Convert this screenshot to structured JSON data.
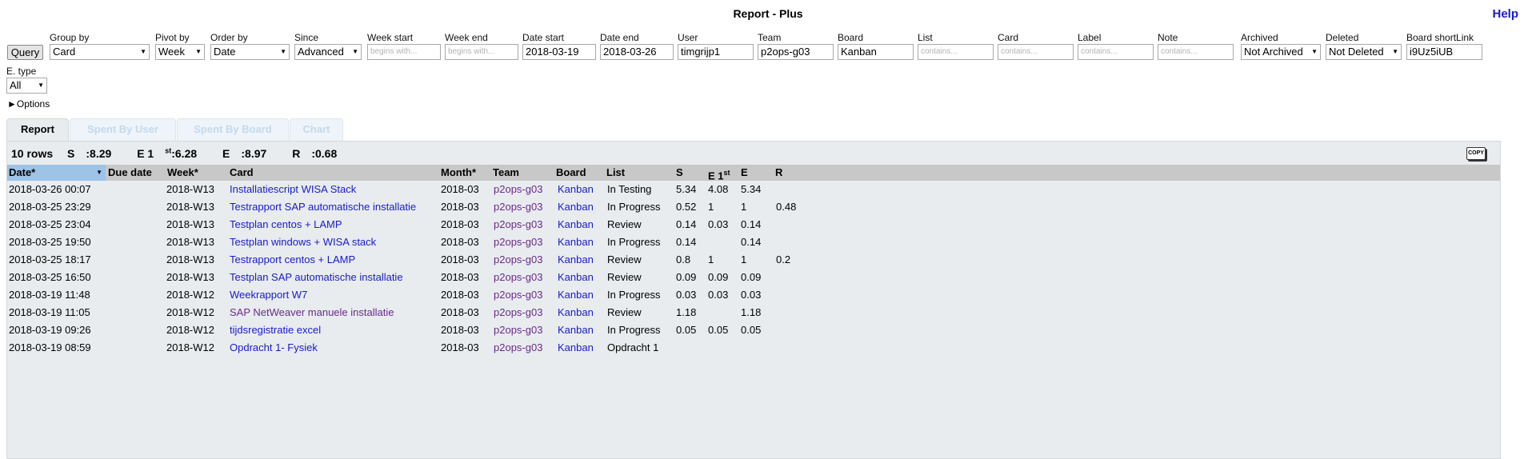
{
  "app": {
    "title": "Report - Plus",
    "help": "Help"
  },
  "query": {
    "label": "Query"
  },
  "filters": {
    "group_by": {
      "label": "Group by",
      "value": "Card"
    },
    "pivot_by": {
      "label": "Pivot by",
      "value": "Week"
    },
    "order_by": {
      "label": "Order by",
      "value": "Date"
    },
    "since": {
      "label": "Since",
      "value": "Advanced"
    },
    "week_start": {
      "label": "Week start",
      "placeholder": "begins with..."
    },
    "week_end": {
      "label": "Week end",
      "placeholder": "begins with..."
    },
    "date_start": {
      "label": "Date start",
      "value": "2018-03-19"
    },
    "date_end": {
      "label": "Date end",
      "value": "2018-03-26"
    },
    "user": {
      "label": "User",
      "value": "timgrijp1"
    },
    "team": {
      "label": "Team",
      "value": "p2ops-g03"
    },
    "board": {
      "label": "Board",
      "value": "Kanban"
    },
    "list": {
      "label": "List",
      "placeholder": "contains..."
    },
    "card": {
      "label": "Card",
      "placeholder": "contains..."
    },
    "label": {
      "label": "Label",
      "placeholder": "contains..."
    },
    "note": {
      "label": "Note",
      "placeholder": "contains..."
    },
    "archived": {
      "label": "Archived",
      "value": "Not Archived"
    },
    "deleted": {
      "label": "Deleted",
      "value": "Not Deleted"
    },
    "board_shortlink": {
      "label": "Board shortLink",
      "value": "i9Uz5iUB"
    },
    "e_type": {
      "label": "E. type",
      "value": "All"
    }
  },
  "options": {
    "label": "►Options"
  },
  "tabs": [
    {
      "label": "Report",
      "active": true
    },
    {
      "label": "Spent By User",
      "active": false
    },
    {
      "label": "Spent By Board",
      "active": false
    },
    {
      "label": "Chart",
      "active": false
    }
  ],
  "summary": {
    "rows": "10 rows",
    "s_label": "S",
    "s_value": "8.29",
    "e1_label": "E 1",
    "e1_sup": "st",
    "e1_value": "6.28",
    "e_label": "E",
    "e_value": "8.97",
    "r_label": "R",
    "r_value": "0.68"
  },
  "copy": {
    "label": "COPY"
  },
  "columns": {
    "date": "Date*",
    "due": "Due date",
    "week": "Week*",
    "card": "Card",
    "month": "Month*",
    "team": "Team",
    "board": "Board",
    "list": "List",
    "s": "S",
    "e1": "E 1",
    "e1_sup": "st",
    "e": "E",
    "r": "R"
  },
  "rows": [
    {
      "date": "2018-03-26 00:07",
      "due": "",
      "week": "2018-W13",
      "card": "Installatiescript WISA Stack",
      "month": "2018-03",
      "team": "p2ops-g03",
      "board": "Kanban",
      "list": "In Testing",
      "s": "5.34",
      "e1": "4.08",
      "e": "5.34",
      "r": ""
    },
    {
      "date": "2018-03-25 23:29",
      "due": "",
      "week": "2018-W13",
      "card": "Testrapport SAP automatische installatie",
      "month": "2018-03",
      "team": "p2ops-g03",
      "board": "Kanban",
      "list": "In Progress",
      "s": "0.52",
      "e1": "1",
      "e": "1",
      "r": "0.48"
    },
    {
      "date": "2018-03-25 23:04",
      "due": "",
      "week": "2018-W13",
      "card": "Testplan centos + LAMP",
      "month": "2018-03",
      "team": "p2ops-g03",
      "board": "Kanban",
      "list": "Review",
      "s": "0.14",
      "e1": "0.03",
      "e": "0.14",
      "r": ""
    },
    {
      "date": "2018-03-25 19:50",
      "due": "",
      "week": "2018-W13",
      "card": "Testplan windows + WISA stack",
      "month": "2018-03",
      "team": "p2ops-g03",
      "board": "Kanban",
      "list": "In Progress",
      "s": "0.14",
      "e1": "",
      "e": "0.14",
      "r": ""
    },
    {
      "date": "2018-03-25 18:17",
      "due": "",
      "week": "2018-W13",
      "card": "Testrapport centos + LAMP",
      "month": "2018-03",
      "team": "p2ops-g03",
      "board": "Kanban",
      "list": "Review",
      "s": "0.8",
      "e1": "1",
      "e": "1",
      "r": "0.2"
    },
    {
      "date": "2018-03-25 16:50",
      "due": "",
      "week": "2018-W13",
      "card": "Testplan SAP automatische installatie",
      "month": "2018-03",
      "team": "p2ops-g03",
      "board": "Kanban",
      "list": "Review",
      "s": "0.09",
      "e1": "0.09",
      "e": "0.09",
      "r": ""
    },
    {
      "date": "2018-03-19 11:48",
      "due": "",
      "week": "2018-W12",
      "card": "Weekrapport W7",
      "month": "2018-03",
      "team": "p2ops-g03",
      "board": "Kanban",
      "list": "In Progress",
      "s": "0.03",
      "e1": "0.03",
      "e": "0.03",
      "r": ""
    },
    {
      "date": "2018-03-19 11:05",
      "due": "",
      "week": "2018-W12",
      "card": "SAP NetWeaver manuele installatie",
      "month": "2018-03",
      "team": "p2ops-g03",
      "board": "Kanban",
      "list": "Review",
      "s": "1.18",
      "e1": "",
      "e": "1.18",
      "r": ""
    },
    {
      "date": "2018-03-19 09:26",
      "due": "",
      "week": "2018-W12",
      "card": "tijdsregistratie excel",
      "month": "2018-03",
      "team": "p2ops-g03",
      "board": "Kanban",
      "list": "In Progress",
      "s": "0.05",
      "e1": "0.05",
      "e": "0.05",
      "r": ""
    },
    {
      "date": "2018-03-19 08:59",
      "due": "",
      "week": "2018-W12",
      "card": "Opdracht 1- Fysiek",
      "month": "2018-03",
      "team": "p2ops-g03",
      "board": "Kanban",
      "list": "Opdracht 1",
      "s": "",
      "e1": "",
      "e": "",
      "r": ""
    }
  ],
  "colors": {
    "link": "#1a1acc",
    "visited": "#6a2a8a",
    "header_bg": "#c8c8c8",
    "sorted_bg": "#9dc3e6",
    "panel_bg": "#e8ecef"
  }
}
